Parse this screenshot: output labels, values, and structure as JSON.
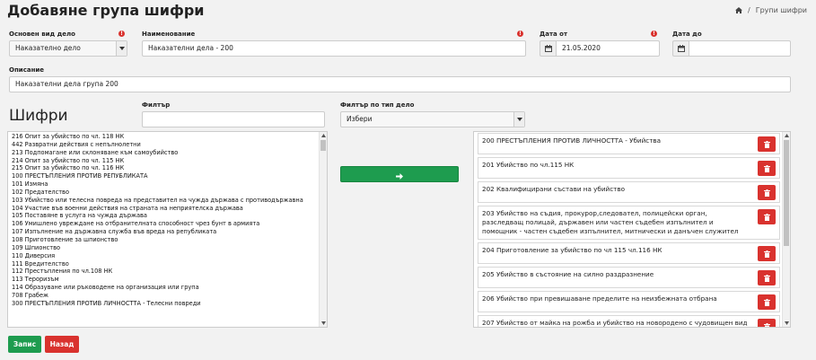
{
  "header": {
    "title": "Добавяне група шифри",
    "breadcrumb": "Групи шифри"
  },
  "form": {
    "case_type_label": "Основен вид дело",
    "case_type_value": "Наказателно дело",
    "name_label": "Наименование",
    "name_value": "Наказателни дела - 200",
    "date_from_label": "Дата от",
    "date_from_value": "21.05.2020",
    "date_to_label": "Дата до",
    "date_to_value": "",
    "description_label": "Описание",
    "description_value": "Наказателни дела група 200",
    "codes_title": "Шифри",
    "filter_label": "Филтър",
    "filter_value": "",
    "filter_type_label": "Филтър по тип дело",
    "filter_type_value": "Избери"
  },
  "codes": [
    "216 Опит за убийство по чл. 118 НК",
    "442 Развратни действия с непълнолетни",
    "213 Подпомагане или склоняване към самоубийство",
    "214 Опит за убийство по чл. 115 НК",
    "215 Опит за убийство по чл. 116 НК",
    "100 ПРЕСТЪПЛЕНИЯ ПРОТИВ РЕПУБЛИКАТА",
    "101 Измяна",
    "102 Предателство",
    "103 Убийство или телесна повреда на представител на чужда държава с противодържавна",
    "104 Участие във военни действия на страната на неприятелска държава",
    "105 Поставяне в услуга на чужда държава",
    "106 Умишлено увреждане на отбранителната способност чрез бунт в армията",
    "107 Изпълнение на държавна служба във вреда на републиката",
    "108 Приготовление за шпионство",
    "109 Шпионство",
    "110 Диверсия",
    "111 Вредителство",
    "112 Престъпления по чл.108 НК",
    "113 Тероризъм",
    "114 Образуване или ръководене на организация или група",
    "708 Грабеж",
    "300 ПРЕСТЪПЛЕНИЯ ПРОТИВ ЛИЧНОСТТА - Телесни повреди"
  ],
  "selected": [
    "200 ПРЕСТЪПЛЕНИЯ ПРОТИВ ЛИЧНОСТТА - Убийства",
    "201 Убийство по чл.115 НК",
    "202 Квалифицирани състави на убийство",
    "203 Убийство на съдия, прокурор,следовател, полицейски орган, разследващ полицай, държавен или частен съдебен изпълнител и помощник - частен съдебен изпълнител, митнически и данъчен служител",
    "204 Приготовление за убийство по чл 115 чл.116 НК",
    "205 Убийство в състояние на силно раздразнение",
    "206 Убийство при превишаване пределите на неизбежната отбрана",
    "207 Убийство от майка на рожба и убийство на новороденo с чудовищен вид"
  ],
  "buttons": {
    "save": "Запис",
    "back": "Назад"
  },
  "colors": {
    "success": "#1e9c4f",
    "danger": "#d9322e"
  }
}
